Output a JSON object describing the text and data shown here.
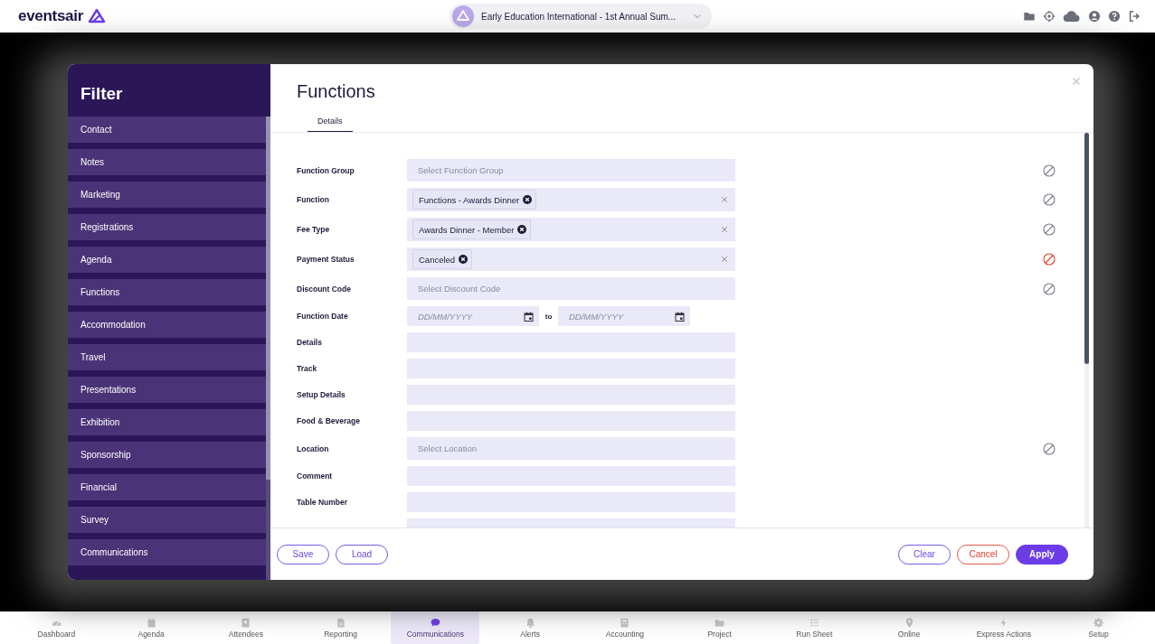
{
  "header": {
    "logo": "eventsair",
    "event": "Early Education International - 1st Annual Sum..."
  },
  "filter": {
    "title": "Filter",
    "items": [
      {
        "label": "Contact"
      },
      {
        "label": "Notes"
      },
      {
        "label": "Marketing"
      },
      {
        "label": "Registrations"
      },
      {
        "label": "Agenda"
      },
      {
        "label": "Functions"
      },
      {
        "label": "Accommodation"
      },
      {
        "label": "Travel"
      },
      {
        "label": "Presentations"
      },
      {
        "label": "Exhibition"
      },
      {
        "label": "Sponsorship"
      },
      {
        "label": "Financial"
      },
      {
        "label": "Survey"
      },
      {
        "label": "Communications"
      }
    ]
  },
  "panel": {
    "title": "Functions",
    "tabs": [
      {
        "label": "Details",
        "selected": true
      }
    ],
    "fields": [
      {
        "label": "Function Group",
        "kind": "select",
        "placeholder": "Select Function Group",
        "exclude_on": false
      },
      {
        "label": "Function",
        "kind": "tags",
        "tags": [
          "Functions - Awards Dinner"
        ],
        "exclude_on": false
      },
      {
        "label": "Fee Type",
        "kind": "tags",
        "tags": [
          "Awards Dinner - Member"
        ],
        "exclude_on": false
      },
      {
        "label": "Payment Status",
        "kind": "tags",
        "tags": [
          "Canceled"
        ],
        "exclude_on": true
      },
      {
        "label": "Discount Code",
        "kind": "select",
        "placeholder": "Select Discount Code",
        "exclude_on": false
      },
      {
        "label": "Function Date",
        "kind": "date",
        "placeholder": "DD/MM/YYYY",
        "to": "to",
        "to_placeholder": "DD/MM/YYYY"
      },
      {
        "label": "Details",
        "kind": "text"
      },
      {
        "label": "Track",
        "kind": "text"
      },
      {
        "label": "Setup Details",
        "kind": "text"
      },
      {
        "label": "Food & Beverage",
        "kind": "text"
      },
      {
        "label": "Location",
        "kind": "select",
        "placeholder": "Select Location",
        "exclude_on": false
      },
      {
        "label": "Comment",
        "kind": "text"
      },
      {
        "label": "Table Number",
        "kind": "text"
      },
      {
        "kind": "text"
      }
    ],
    "buttons_left": [
      "Save",
      "Load"
    ],
    "buttons_right": [
      {
        "label": "Clear",
        "kind": "outline"
      },
      {
        "label": "Cancel",
        "kind": "danger"
      },
      {
        "label": "Apply",
        "kind": "primary"
      }
    ]
  },
  "nav": [
    {
      "label": "Dashboard",
      "selected": false
    },
    {
      "label": "Agenda",
      "selected": false
    },
    {
      "label": "Attendees",
      "selected": false
    },
    {
      "label": "Reporting",
      "selected": false
    },
    {
      "label": "Communications",
      "selected": true
    },
    {
      "label": "Alerts",
      "selected": false
    },
    {
      "label": "Accounting",
      "selected": false
    },
    {
      "label": "Project",
      "selected": false
    },
    {
      "label": "Run Sheet",
      "selected": false
    },
    {
      "label": "Online",
      "selected": false
    },
    {
      "label": "Express Actions",
      "selected": false
    },
    {
      "label": "Setup",
      "selected": false
    }
  ]
}
